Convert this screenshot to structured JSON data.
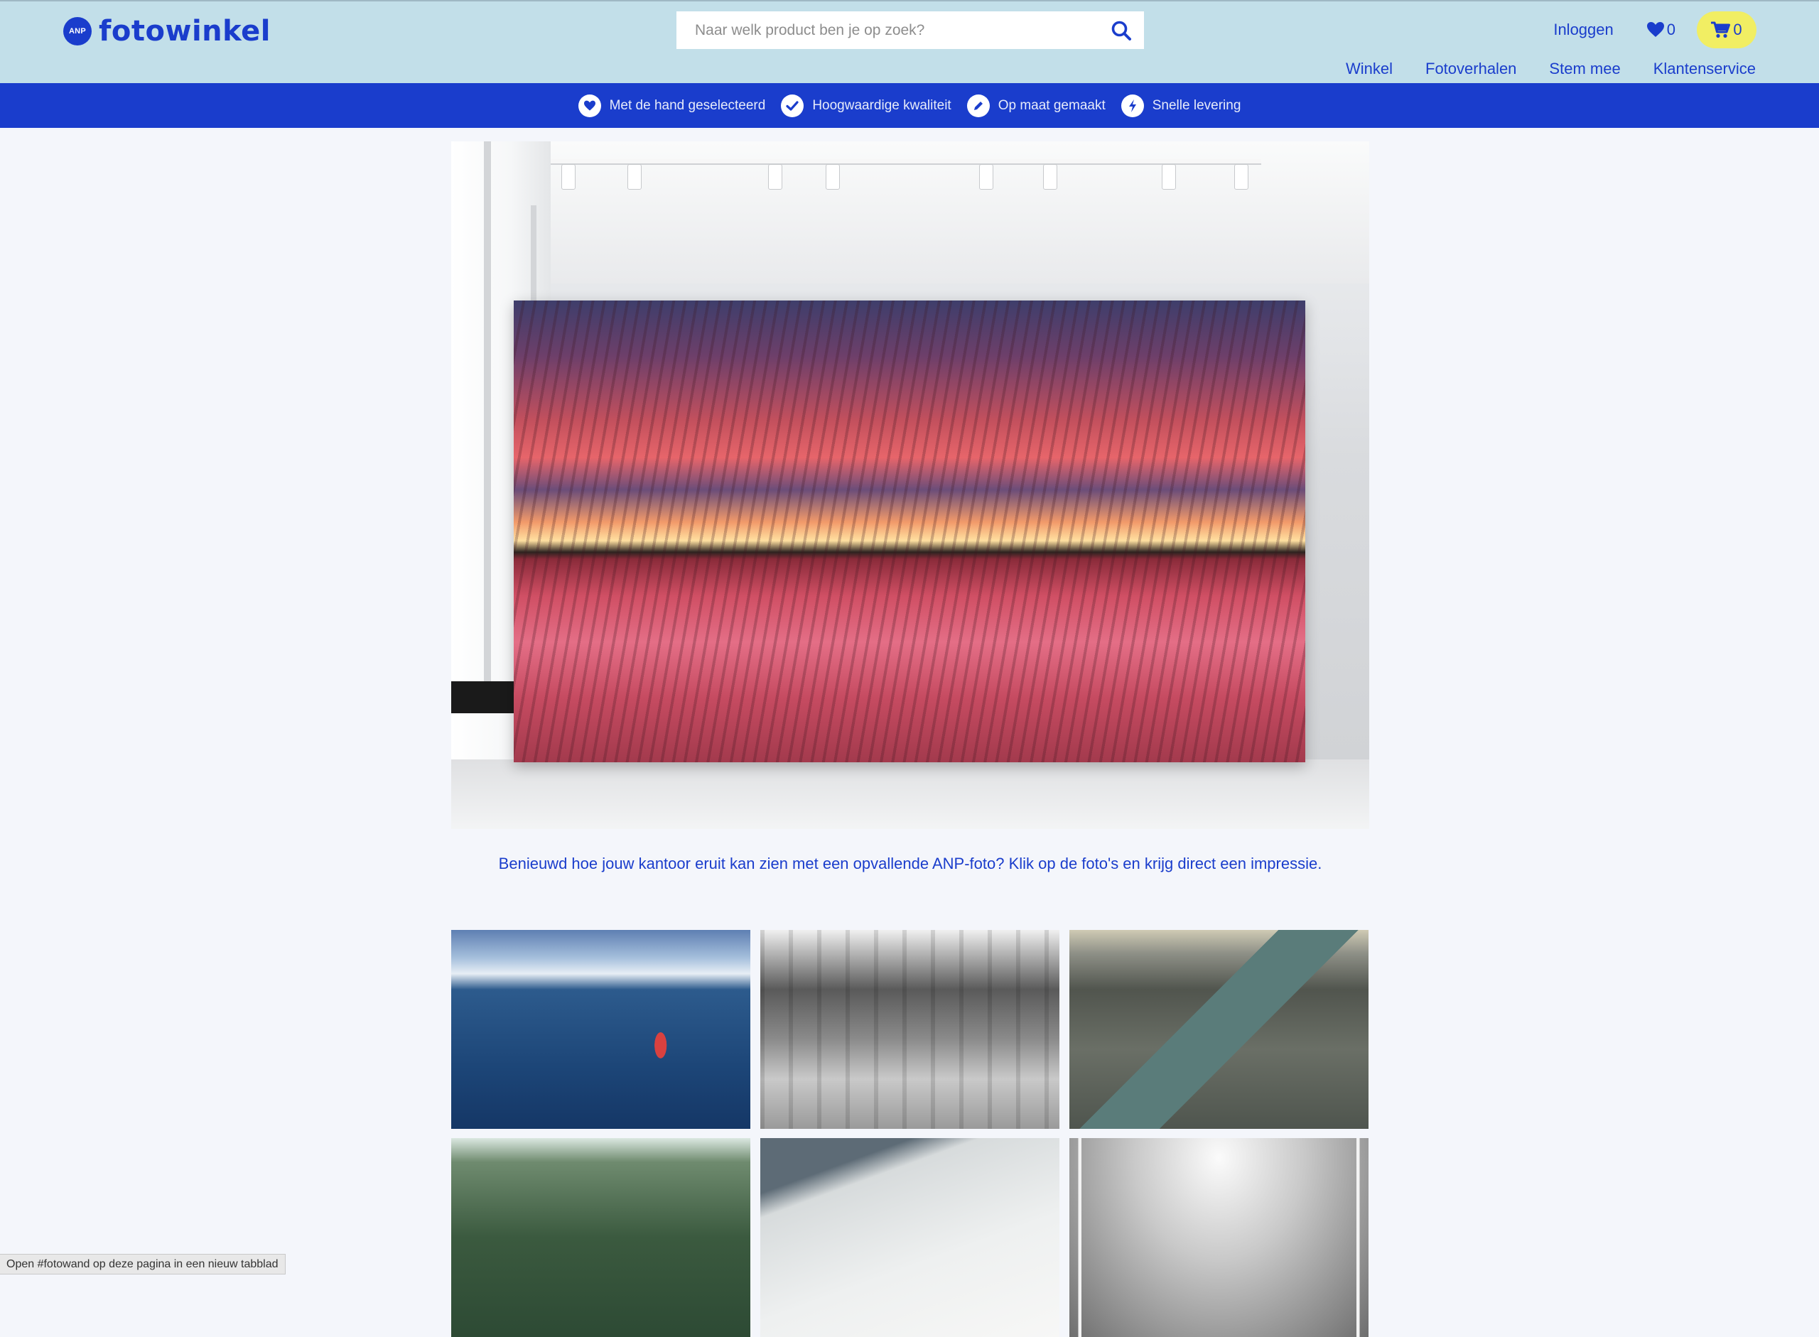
{
  "header": {
    "logo_badge": "ANP",
    "logo_text": "fotowinkel",
    "search_placeholder": "Naar welk product ben je op zoek?",
    "login_label": "Inloggen",
    "favorites_count": "0",
    "cart_count": "0",
    "nav": [
      "Winkel",
      "Fotoverhalen",
      "Stem mee",
      "Klantenservice"
    ]
  },
  "usp_bar": [
    {
      "label": "Met de hand geselecteerd",
      "icon": "heart-icon"
    },
    {
      "label": "Hoogwaardige kwaliteit",
      "icon": "check-icon"
    },
    {
      "label": "Op maat gemaakt",
      "icon": "pencil-icon"
    },
    {
      "label": "Snelle levering",
      "icon": "lightning-icon"
    }
  ],
  "caption": "Benieuwd hoe jouw kantoor eruit kan zien met een opvallende ANP-foto? Klik op de foto's en krijg direct een impressie.",
  "status_bar": "Open #fotowand op deze pagina in een nieuw tabblad",
  "colors": {
    "brand_blue": "#1a3dcc",
    "header_bg": "#c2dfe9",
    "cart_yellow": "#f1ee63",
    "page_bg": "#f4f6fb"
  }
}
